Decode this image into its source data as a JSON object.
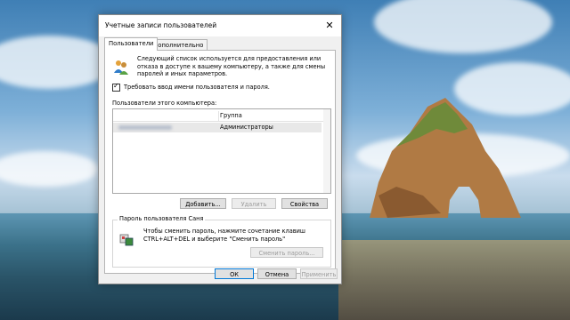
{
  "dialog": {
    "title": "Учетные записи пользователей",
    "close_label": "✕"
  },
  "tabs": [
    {
      "label": "Пользователи",
      "active": true
    },
    {
      "label": "Дополнительно",
      "active": false
    }
  ],
  "users_tab": {
    "intro_text": "Следующий список используется для предоставления или отказа в доступе к вашему компьютеру, а также для смены паролей и иных параметров.",
    "require_login_label": "Требовать ввод имени пользователя и пароля.",
    "require_login_checked": true,
    "users_label": "Пользователи этого компьютера:",
    "columns": [
      "",
      "Группа"
    ],
    "rows": [
      {
        "name": "",
        "group": "Администраторы"
      }
    ],
    "buttons": {
      "add": "Добавить...",
      "remove": "Удалить",
      "properties": "Свойства"
    },
    "password_group": {
      "title": "Пароль пользователя Саня",
      "text": "Чтобы сменить пароль, нажмите сочетание клавиш CTRL+ALT+DEL и выберите \"Сменить пароль\"",
      "change_button": "Сменить пароль..."
    }
  },
  "footer_buttons": {
    "ok": "ОК",
    "cancel": "Отмена",
    "apply": "Применить"
  },
  "icons": {
    "close": "close-icon",
    "users": "users-icon",
    "key": "keyboard-key-icon",
    "checkbox": "checkmark-icon"
  },
  "colors": {
    "accent": "#0078d7",
    "disabled_text": "#9c9c9c",
    "selected_row": "#e8e8e8"
  }
}
